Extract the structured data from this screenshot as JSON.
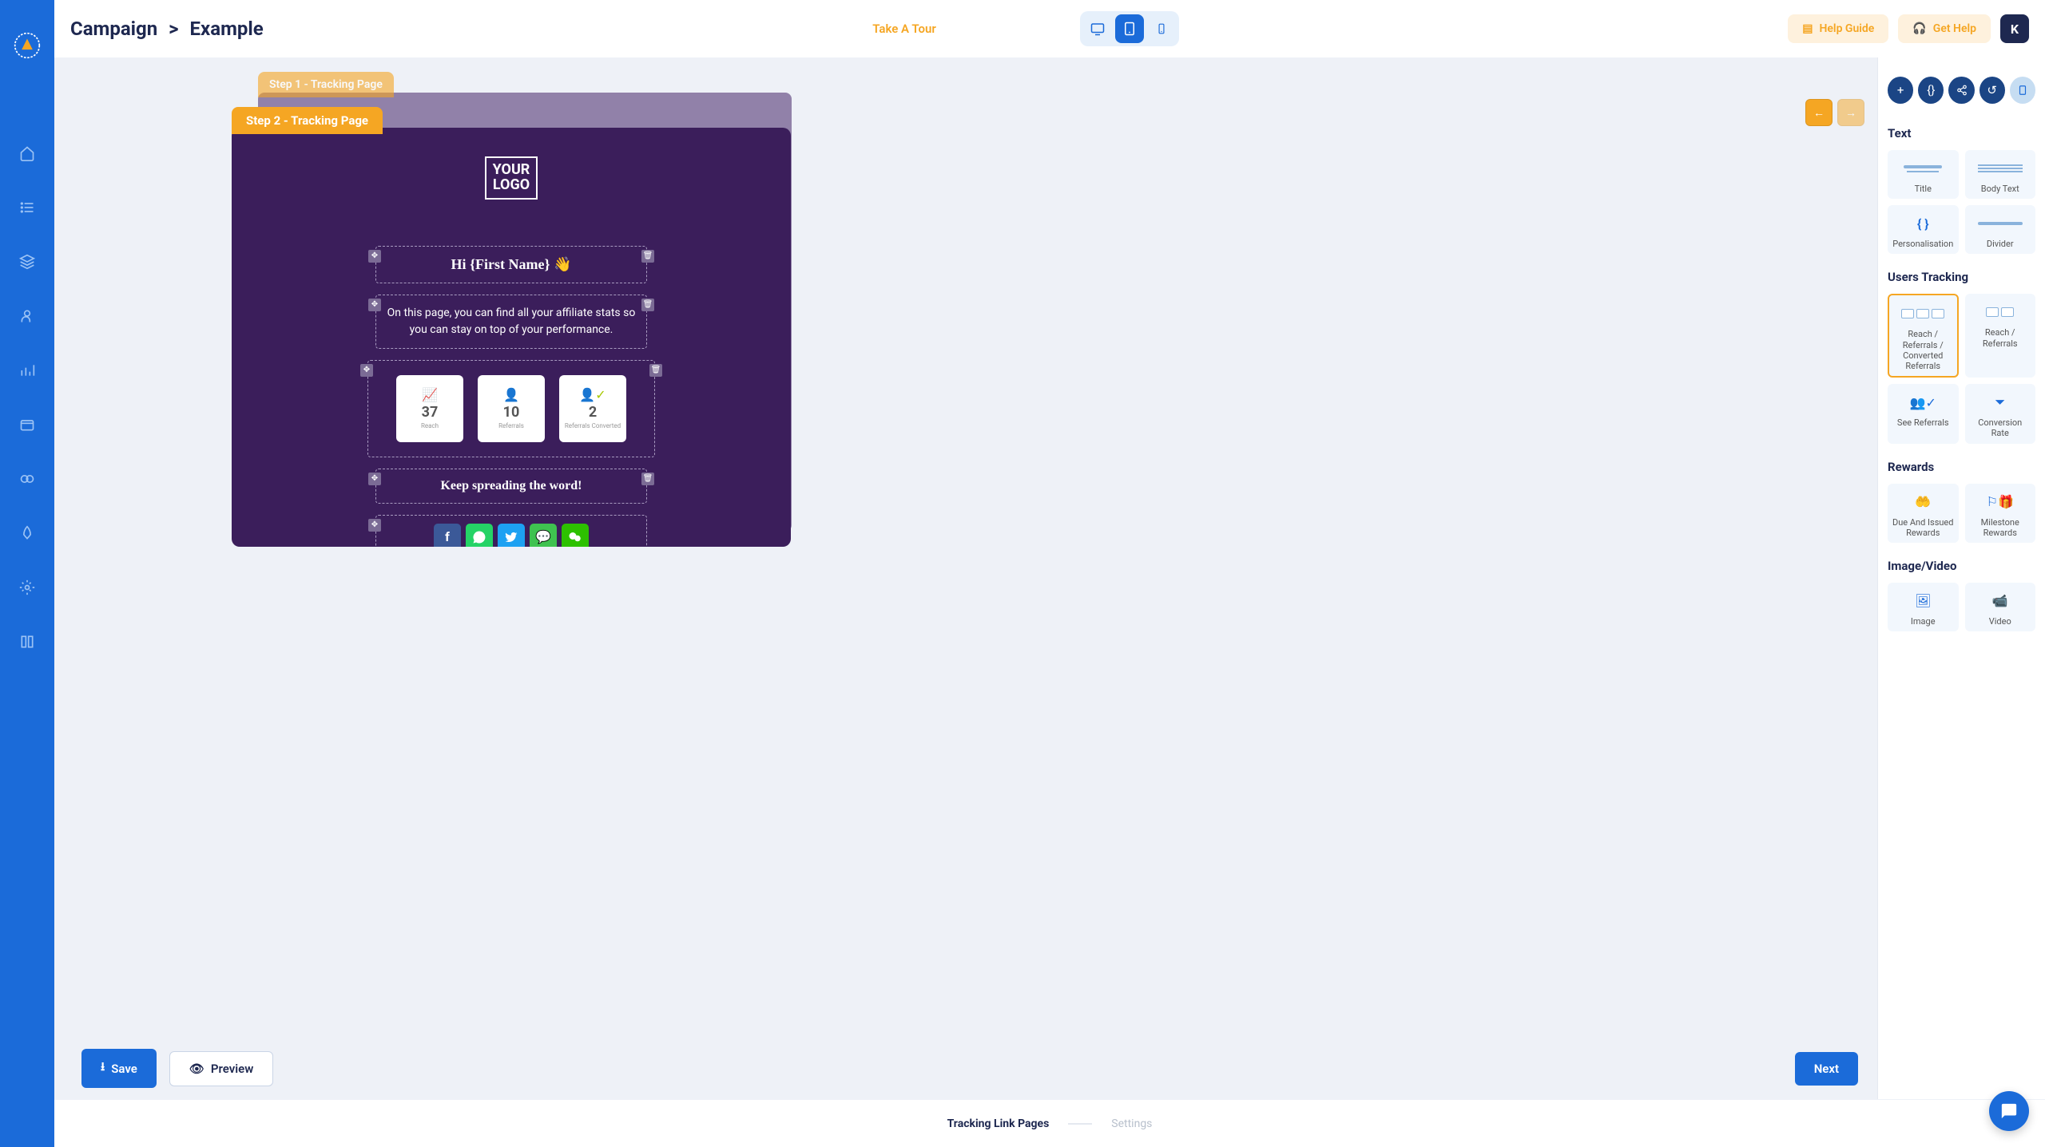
{
  "breadcrumb": {
    "root": "Campaign",
    "sep": ">",
    "current": "Example"
  },
  "header": {
    "tour": "Take A Tour",
    "help_guide": "Help Guide",
    "get_help": "Get Help",
    "avatar": "K"
  },
  "steps": {
    "step1_label": "Step 1 - Tracking Page",
    "step2_label": "Step 2 - Tracking Page"
  },
  "preview": {
    "logo_line1": "YOUR",
    "logo_line2": "LOGO",
    "greeting": "Hi {First Name} 👋",
    "body": "On this page, you can find all your affiliate stats so you can stay on top of your performance.",
    "stats": [
      {
        "value": "37",
        "label": "Reach"
      },
      {
        "value": "10",
        "label": "Referrals"
      },
      {
        "value": "2",
        "label": "Referrals Converted"
      }
    ],
    "spread": "Keep spreading the word!",
    "social_colors": {
      "facebook": "#3b5998",
      "whatsapp": "#25d366",
      "twitter": "#1da1f2",
      "sms": "#3fc250",
      "wechat": "#2dc100"
    }
  },
  "actions": {
    "save": "Save",
    "preview": "Preview",
    "next": "Next"
  },
  "panel": {
    "sections": {
      "text": "Text",
      "users_tracking": "Users Tracking",
      "rewards": "Rewards",
      "image_video": "Image/Video"
    },
    "components": {
      "title": "Title",
      "body_text": "Body Text",
      "personalisation": "Personalisation",
      "divider": "Divider",
      "rrc": "Reach / Referrals / Converted Referrals",
      "rr": "Reach / Referrals",
      "see_referrals": "See Referrals",
      "conversion_rate": "Conversion Rate",
      "due_issued": "Due And Issued Rewards",
      "milestone": "Milestone Rewards",
      "image": "Image",
      "video": "Video"
    }
  },
  "footer": {
    "tracking": "Tracking Link Pages",
    "settings": "Settings"
  }
}
